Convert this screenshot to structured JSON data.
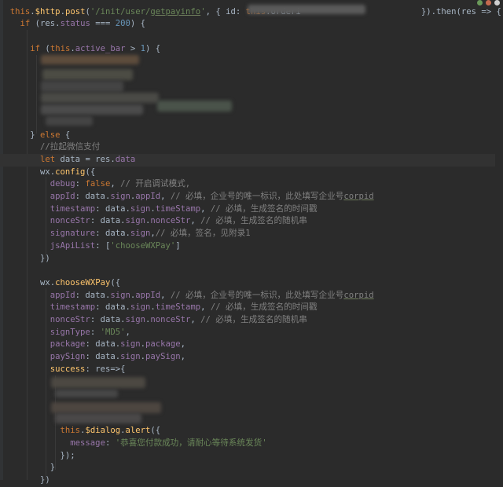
{
  "editor": {
    "lines": [
      [
        [
          "plain",
          "  "
        ],
        [
          "kw",
          "this"
        ],
        [
          "plain",
          "."
        ],
        [
          "fn",
          "$http"
        ],
        [
          "plain",
          "."
        ],
        [
          "fn",
          "post"
        ],
        [
          "plain",
          "("
        ],
        [
          "str",
          "'/init/user/"
        ],
        [
          "str ul",
          "getpayinfo"
        ],
        [
          "str",
          "'"
        ],
        [
          "plain",
          ", { "
        ],
        [
          "plain",
          "id"
        ],
        [
          "plain",
          ": "
        ],
        [
          "kw",
          "this"
        ],
        [
          "plain",
          ".orderi                        }).then(res => {"
        ]
      ],
      [
        [
          "plain",
          "    "
        ],
        [
          "kw",
          "if"
        ],
        [
          "plain",
          " (res."
        ],
        [
          "prop",
          "status"
        ],
        [
          "plain",
          " === "
        ],
        [
          "num",
          "200"
        ],
        [
          "plain",
          ") {"
        ]
      ],
      [
        [
          "plain",
          ""
        ]
      ],
      [
        [
          "plain",
          "      "
        ],
        [
          "kw",
          "if"
        ],
        [
          "plain",
          " ("
        ],
        [
          "kw",
          "this"
        ],
        [
          "plain",
          "."
        ],
        [
          "prop",
          "active_bar"
        ],
        [
          "plain",
          " > "
        ],
        [
          "num",
          "1"
        ],
        [
          "plain",
          ") {"
        ]
      ],
      [
        [
          "plain",
          ""
        ]
      ],
      [
        [
          "plain",
          ""
        ]
      ],
      [
        [
          "plain",
          ""
        ]
      ],
      [
        [
          "plain",
          ""
        ]
      ],
      [
        [
          "plain",
          ""
        ]
      ],
      [
        [
          "plain",
          ""
        ]
      ],
      [
        [
          "plain",
          "      } "
        ],
        [
          "kw",
          "else"
        ],
        [
          "plain",
          " {"
        ]
      ],
      [
        [
          "plain",
          "        "
        ],
        [
          "cm",
          "//拉起微信支付"
        ]
      ],
      [
        [
          "plain",
          "        "
        ],
        [
          "kw",
          "let"
        ],
        [
          "plain",
          " data = res."
        ],
        [
          "prop",
          "data"
        ]
      ],
      [
        [
          "plain",
          "        wx."
        ],
        [
          "fn",
          "config"
        ],
        [
          "plain",
          "({"
        ]
      ],
      [
        [
          "plain",
          "          "
        ],
        [
          "prop",
          "debug"
        ],
        [
          "plain",
          ": "
        ],
        [
          "kw",
          "false"
        ],
        [
          "plain",
          ", "
        ],
        [
          "cm",
          "// 开启调试模式,"
        ]
      ],
      [
        [
          "plain",
          "          "
        ],
        [
          "prop",
          "appId"
        ],
        [
          "plain",
          ": data."
        ],
        [
          "prop",
          "sign"
        ],
        [
          "plain",
          "."
        ],
        [
          "prop",
          "appId"
        ],
        [
          "plain",
          ", "
        ],
        [
          "cm",
          "// 必填，企业号的唯一标识，此处填写企业号"
        ],
        [
          "cm ul",
          "corpid"
        ]
      ],
      [
        [
          "plain",
          "          "
        ],
        [
          "prop",
          "timestamp"
        ],
        [
          "plain",
          ": data."
        ],
        [
          "prop",
          "sign"
        ],
        [
          "plain",
          "."
        ],
        [
          "prop",
          "timeStamp"
        ],
        [
          "plain",
          ", "
        ],
        [
          "cm",
          "// 必填，生成签名的时间戳"
        ]
      ],
      [
        [
          "plain",
          "          "
        ],
        [
          "prop",
          "nonceStr"
        ],
        [
          "plain",
          ": data."
        ],
        [
          "prop",
          "sign"
        ],
        [
          "plain",
          "."
        ],
        [
          "prop",
          "nonceStr"
        ],
        [
          "plain",
          ", "
        ],
        [
          "cm",
          "// 必填，生成签名的随机串"
        ]
      ],
      [
        [
          "plain",
          "          "
        ],
        [
          "prop",
          "signature"
        ],
        [
          "plain",
          ": data."
        ],
        [
          "prop",
          "sign"
        ],
        [
          "plain",
          ","
        ],
        [
          "cm",
          "// 必填，签名，见附录1"
        ]
      ],
      [
        [
          "plain",
          "          "
        ],
        [
          "prop",
          "jsApiList"
        ],
        [
          "plain",
          ": ["
        ],
        [
          "str",
          "'chooseWXPay'"
        ],
        [
          "plain",
          "]"
        ]
      ],
      [
        [
          "plain",
          "        })"
        ]
      ],
      [
        [
          "plain",
          ""
        ]
      ],
      [
        [
          "plain",
          "        wx."
        ],
        [
          "fn",
          "chooseWXPay"
        ],
        [
          "plain",
          "({"
        ]
      ],
      [
        [
          "plain",
          "          "
        ],
        [
          "prop",
          "appId"
        ],
        [
          "plain",
          ": data."
        ],
        [
          "prop",
          "sign"
        ],
        [
          "plain",
          "."
        ],
        [
          "prop",
          "appId"
        ],
        [
          "plain",
          ", "
        ],
        [
          "cm",
          "// 必填，企业号的唯一标识，此处填写企业号"
        ],
        [
          "cm ul",
          "corpid"
        ]
      ],
      [
        [
          "plain",
          "          "
        ],
        [
          "prop",
          "timestamp"
        ],
        [
          "plain",
          ": data."
        ],
        [
          "prop",
          "sign"
        ],
        [
          "plain",
          "."
        ],
        [
          "prop",
          "timeStamp"
        ],
        [
          "plain",
          ", "
        ],
        [
          "cm",
          "// 必填，生成签名的时间戳"
        ]
      ],
      [
        [
          "plain",
          "          "
        ],
        [
          "prop",
          "nonceStr"
        ],
        [
          "plain",
          ": data."
        ],
        [
          "prop",
          "sign"
        ],
        [
          "plain",
          "."
        ],
        [
          "prop",
          "nonceStr"
        ],
        [
          "plain",
          ", "
        ],
        [
          "cm",
          "// 必填，生成签名的随机串"
        ]
      ],
      [
        [
          "plain",
          "          "
        ],
        [
          "prop",
          "signType"
        ],
        [
          "plain",
          ": "
        ],
        [
          "str",
          "'MD5'"
        ],
        [
          "plain",
          ","
        ]
      ],
      [
        [
          "plain",
          "          "
        ],
        [
          "prop",
          "package"
        ],
        [
          "plain",
          ": data."
        ],
        [
          "prop",
          "sign"
        ],
        [
          "plain",
          "."
        ],
        [
          "prop",
          "package"
        ],
        [
          "plain",
          ","
        ]
      ],
      [
        [
          "plain",
          "          "
        ],
        [
          "prop",
          "paySign"
        ],
        [
          "plain",
          ": data."
        ],
        [
          "prop",
          "sign"
        ],
        [
          "plain",
          "."
        ],
        [
          "prop",
          "paySign"
        ],
        [
          "plain",
          ","
        ]
      ],
      [
        [
          "plain",
          "          "
        ],
        [
          "fn",
          "success"
        ],
        [
          "plain",
          ": res=>{"
        ]
      ],
      [
        [
          "plain",
          ""
        ]
      ],
      [
        [
          "plain",
          ""
        ]
      ],
      [
        [
          "plain",
          ""
        ]
      ],
      [
        [
          "plain",
          ""
        ]
      ],
      [
        [
          "plain",
          "            "
        ],
        [
          "kw",
          "this"
        ],
        [
          "plain",
          "."
        ],
        [
          "fn",
          "$dialog"
        ],
        [
          "plain",
          "."
        ],
        [
          "fn",
          "alert"
        ],
        [
          "plain",
          "({"
        ]
      ],
      [
        [
          "plain",
          "              "
        ],
        [
          "prop",
          "message"
        ],
        [
          "plain",
          ": "
        ],
        [
          "str",
          "'恭喜您付款成功，请耐心等待系统发货'"
        ]
      ],
      [
        [
          "plain",
          "            });"
        ]
      ],
      [
        [
          "plain",
          "          }"
        ]
      ],
      [
        [
          "plain",
          "        })"
        ]
      ]
    ],
    "current_line": 12,
    "colors": {
      "background": "#2b2b2b",
      "keyword": "#cc7832",
      "function": "#ffc66d",
      "property": "#9876aa",
      "string": "#6a8759",
      "number": "#6897bb",
      "comment": "#808080"
    }
  }
}
